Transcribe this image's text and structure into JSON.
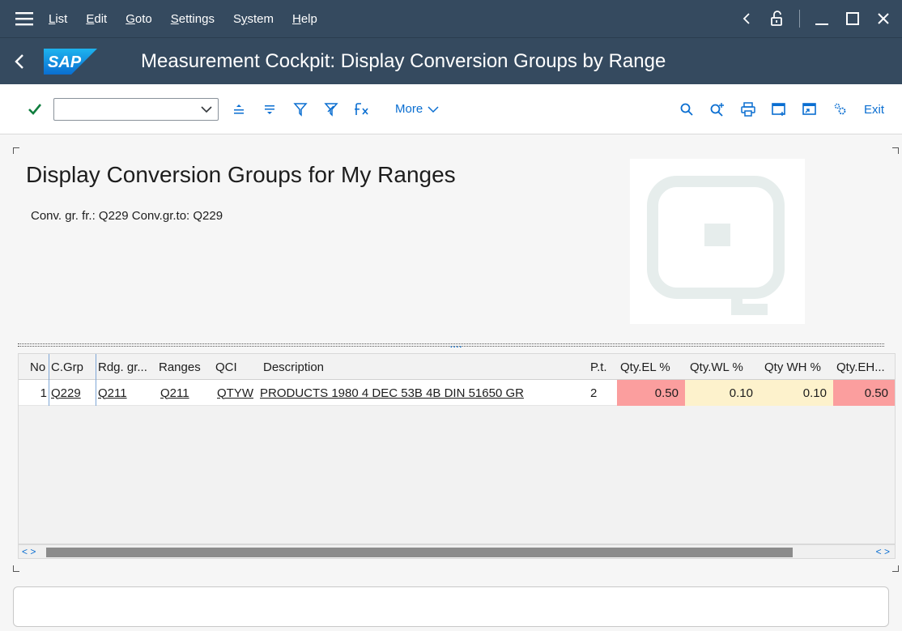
{
  "menu": {
    "items": [
      "List",
      "Edit",
      "Goto",
      "Settings",
      "System",
      "Help"
    ],
    "underline": [
      "L",
      "E",
      "G",
      "S",
      "y",
      "H"
    ]
  },
  "title": {
    "logo_text": "SAP",
    "text": "Measurement Cockpit: Display Conversion Groups by Range"
  },
  "toolbar": {
    "command_placeholder": "",
    "more_label": "More",
    "exit_label": "Exit"
  },
  "header": {
    "heading": "Display Conversion Groups for My Ranges",
    "subheading": "Conv. gr. fr.: Q229 Conv.gr.to: Q229"
  },
  "splitter_grip": "....",
  "table": {
    "columns": [
      "No",
      "C.Grp",
      "Rdg. gr...",
      "Ranges",
      "QCI",
      "Description",
      "P.t.",
      "Qty.EL %",
      "Qty.WL %",
      "Qty WH %",
      "Qty.EH..."
    ],
    "rows": [
      {
        "no": "1",
        "cgrp": "Q229",
        "rdg": "Q211",
        "ranges": "Q211",
        "qci": "QTYW",
        "description": "PRODUCTS 1980 4 DEC 53B 4B DIN 51650 GR",
        "pt": "2",
        "qty_el": "0.50",
        "qty_wl": "0.10",
        "qty_wh": "0.10",
        "qty_eh": "0.50"
      }
    ]
  },
  "scroll": {
    "left_arrows": "< >",
    "right_arrows": "< >"
  },
  "colors": {
    "shell": "#354a5f",
    "accent": "#0a6ed1",
    "critical": "#fb9e9e",
    "warning": "#fdf2cc",
    "confirm": "#107e3e"
  }
}
